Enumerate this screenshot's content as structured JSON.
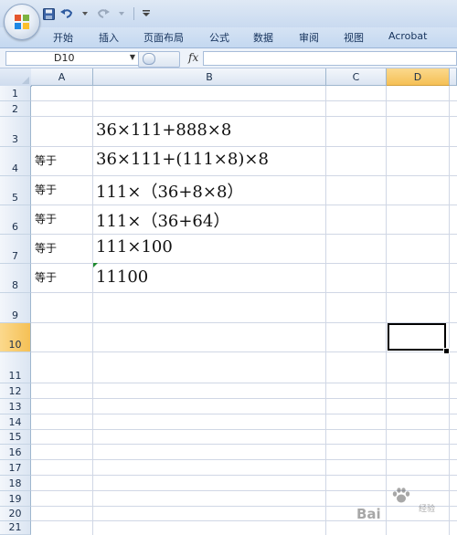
{
  "toolbar": {
    "save_icon": "save-icon",
    "undo_icon": "undo-icon",
    "redo_icon": "redo-icon",
    "customize_icon": "customize-arrow-icon"
  },
  "ribbon": {
    "tabs": [
      "开始",
      "插入",
      "页面布局",
      "公式",
      "数据",
      "审阅",
      "视图",
      "Acrobat"
    ]
  },
  "formula_bar": {
    "name_box": "D10",
    "fx_label": "fx",
    "formula": ""
  },
  "grid": {
    "columns": [
      "A",
      "B",
      "C",
      "D"
    ],
    "selected_column": "D",
    "rows": [
      "1",
      "2",
      "3",
      "4",
      "5",
      "6",
      "7",
      "8",
      "9",
      "10",
      "11",
      "12",
      "13",
      "14",
      "15",
      "16",
      "17",
      "18",
      "19",
      "20",
      "21"
    ],
    "selected_row": "10",
    "active_cell": "D10",
    "cells": {
      "A3": "",
      "B3": "36×111+888×8",
      "A4": "等于",
      "B4": "36×111+(111×8)×8",
      "A5": "等于",
      "B5": "111×（36+8×8）",
      "A6": "等于",
      "B6": "111×（36+64）",
      "A7": "等于",
      "B7": "111×100",
      "A8": "等于",
      "B8": "11100"
    }
  },
  "watermark": {
    "text": "Bai",
    "sub": "经验"
  },
  "colors": {
    "ribbon": "#c4d8f0",
    "header_selected": "#f5c055",
    "gridline": "#d0d7e5",
    "error_indicator": "#1e8a2e"
  }
}
